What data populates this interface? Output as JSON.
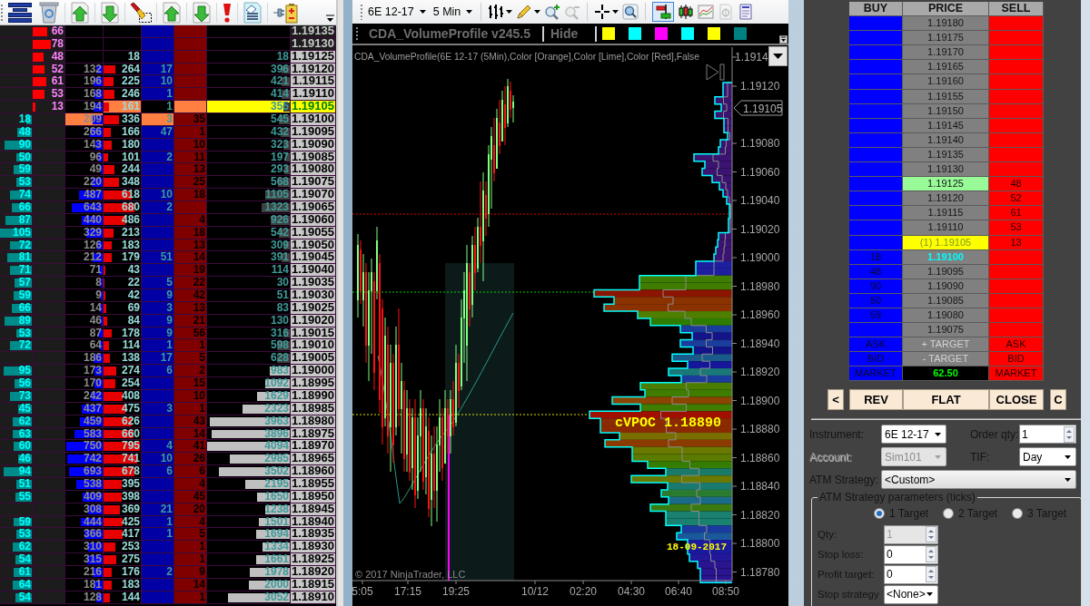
{
  "ladder": {
    "rows": [
      {
        "cells": [
          null,
          {
            "text": "66",
            "level": 0.47
          },
          null,
          null,
          null,
          null,
          null,
          {
            "text": "1.19135",
            "highlight": {
              "color": "#1c1c1c"
            }
          }
        ]
      },
      {
        "cells": [
          null,
          {
            "text": "78",
            "level": 0.56
          },
          null,
          null,
          null,
          null,
          null,
          {
            "text": "1.19130",
            "highlight": {
              "color": "#1c1c1c"
            }
          }
        ]
      },
      {
        "cells": [
          null,
          {
            "text": "48",
            "level": 0.34
          },
          null,
          {
            "text": "18"
          },
          null,
          null,
          {
            "text": "18"
          },
          {
            "text": "1.19125"
          }
        ]
      },
      {
        "cells": [
          null,
          {
            "text": "52",
            "level": 0.37
          },
          {
            "text": "132",
            "level": 0.17
          },
          {
            "text": "264",
            "level": 0.32
          },
          {
            "text": "17"
          },
          null,
          {
            "text": "396",
            "level": 0.1,
            "color": "#404040"
          },
          {
            "text": "1.19120"
          }
        ]
      },
      {
        "cells": [
          null,
          {
            "text": "61",
            "level": 0.44
          },
          {
            "text": "196",
            "level": 0.25
          },
          {
            "text": "225",
            "level": 0.27
          },
          {
            "text": "10"
          },
          null,
          {
            "text": "421",
            "level": 0.1,
            "color": "#404040"
          },
          {
            "text": "1.19115"
          }
        ]
      },
      {
        "cells": [
          null,
          {
            "text": "53",
            "level": 0.38
          },
          {
            "text": "168",
            "level": 0.22
          },
          {
            "text": "246",
            "level": 0.3
          },
          {
            "text": "1"
          },
          null,
          {
            "text": "414",
            "level": 0.1,
            "color": "#404040"
          },
          {
            "text": "1.19110"
          }
        ]
      },
      {
        "cells": [
          null,
          {
            "text": "13",
            "level": 0.09
          },
          {
            "text": "194",
            "level": 0.25
          },
          {
            "text": "161",
            "level": 0.15,
            "highlight": {
              "color": "#ff8040"
            }
          },
          {
            "text": "1",
            "highlight": {
              "color": "#000000"
            }
          },
          {
            "highlight": {
              "color": "#ff8040"
            }
          },
          {
            "text": "355",
            "level": 0.08,
            "color": "#404040",
            "highlight": {
              "color": "#ffff00"
            }
          },
          {
            "text": "1.19105",
            "highlight": {
              "color": "#ffff00"
            }
          }
        ]
      },
      {
        "cells": [
          {
            "text": "18",
            "level": 0.17
          },
          null,
          {
            "text": "209",
            "level": 0.27,
            "highlight": {
              "color": "#ff8040"
            }
          },
          {
            "text": "336",
            "level": 0.41
          },
          {
            "text": "3",
            "highlight": {
              "color": "#ff8040"
            }
          },
          {
            "text": "35"
          },
          {
            "text": "545",
            "level": 0.13,
            "color": "#404040"
          },
          {
            "text": "1.19100"
          }
        ]
      },
      {
        "cells": [
          {
            "text": "48",
            "level": 0.46
          },
          null,
          {
            "text": "266",
            "level": 0.35
          },
          {
            "text": "166",
            "level": 0.2
          },
          {
            "text": "47"
          },
          {
            "text": "1"
          },
          {
            "text": "432",
            "level": 0.11,
            "color": "#404040"
          },
          {
            "text": "1.19095"
          }
        ]
      },
      {
        "cells": [
          {
            "text": "90",
            "level": 0.86
          },
          null,
          {
            "text": "143",
            "level": 0.19
          },
          {
            "text": "180",
            "level": 0.22
          },
          null,
          {
            "text": "10"
          },
          {
            "text": "323",
            "level": 0.08,
            "color": "#404040"
          },
          {
            "text": "1.19090"
          }
        ]
      },
      {
        "cells": [
          {
            "text": "50",
            "level": 0.48
          },
          null,
          {
            "text": "96",
            "level": 0.12
          },
          {
            "text": "101",
            "level": 0.12
          },
          {
            "text": "2"
          },
          {
            "text": "11"
          },
          {
            "text": "197",
            "level": 0.05,
            "color": "#404040"
          },
          {
            "text": "1.19085"
          }
        ]
      },
      {
        "cells": [
          {
            "text": "59",
            "level": 0.56
          },
          null,
          {
            "text": "49",
            "level": 0.06
          },
          {
            "text": "244",
            "level": 0.3
          },
          null,
          {
            "text": "13"
          },
          {
            "text": "293",
            "level": 0.07,
            "color": "#404040"
          },
          {
            "text": "1.19080"
          }
        ]
      },
      {
        "cells": [
          {
            "text": "53",
            "level": 0.5
          },
          null,
          {
            "text": "220",
            "level": 0.29
          },
          {
            "text": "348",
            "level": 0.42
          },
          null,
          {
            "text": "25"
          },
          {
            "text": "568",
            "level": 0.14,
            "color": "#404040"
          },
          {
            "text": "1.19075"
          }
        ]
      },
      {
        "cells": [
          {
            "text": "74",
            "level": 0.7
          },
          null,
          {
            "text": "487",
            "level": 0.63
          },
          {
            "text": "618",
            "level": 0.75
          },
          {
            "text": "10"
          },
          {
            "text": "18"
          },
          {
            "text": "1105",
            "level": 0.3,
            "color": "#404040"
          },
          {
            "text": "1.19070"
          }
        ]
      },
      {
        "cells": [
          {
            "text": "66",
            "level": 0.63
          },
          null,
          {
            "text": "643",
            "level": 0.84
          },
          {
            "text": "680",
            "level": 0.83
          },
          {
            "text": "2"
          },
          null,
          {
            "text": "1323",
            "level": 0.34,
            "color": "#404040"
          },
          {
            "text": "1.19065"
          }
        ]
      },
      {
        "cells": [
          {
            "text": "87",
            "level": 0.83
          },
          null,
          {
            "text": "440",
            "level": 0.57
          },
          {
            "text": "486",
            "level": 0.59
          },
          null,
          {
            "text": "4"
          },
          {
            "text": "926",
            "level": 0.23,
            "color": "#404040"
          },
          {
            "text": "1.19060"
          }
        ]
      },
      {
        "cells": [
          {
            "text": "105",
            "level": 1
          },
          null,
          {
            "text": "329",
            "level": 0.43
          },
          {
            "text": "213",
            "level": 0.26
          },
          null,
          {
            "text": "18"
          },
          {
            "text": "542",
            "level": 0.13,
            "color": "#404040"
          },
          {
            "text": "1.19055"
          }
        ]
      },
      {
        "cells": [
          {
            "text": "72",
            "level": 0.69
          },
          null,
          {
            "text": "126",
            "level": 0.16
          },
          {
            "text": "183",
            "level": 0.22
          },
          null,
          {
            "text": "13"
          },
          {
            "text": "309",
            "level": 0.08,
            "color": "#404040"
          },
          {
            "text": "1.19050"
          }
        ]
      },
      {
        "cells": [
          {
            "text": "81",
            "level": 0.77
          },
          null,
          {
            "text": "212",
            "level": 0.28
          },
          {
            "text": "179",
            "level": 0.22
          },
          {
            "text": "51"
          },
          {
            "text": "14"
          },
          {
            "text": "391",
            "level": 0.1,
            "color": "#404040"
          },
          {
            "text": "1.19045"
          }
        ]
      },
      {
        "cells": [
          {
            "text": "71",
            "level": 0.68
          },
          null,
          {
            "text": "71",
            "level": 0.09
          },
          {
            "text": "43",
            "level": 0.05
          },
          null,
          {
            "text": "19"
          },
          {
            "text": "114"
          },
          {
            "text": "1.19040"
          }
        ]
      },
      {
        "cells": [
          {
            "text": "57",
            "level": 0.54
          },
          null,
          {
            "text": "8",
            "level": 0.04
          },
          {
            "text": "22",
            "level": 0.03
          },
          {
            "text": "5"
          },
          {
            "text": "22"
          },
          {
            "text": "30"
          },
          {
            "text": "1.19035"
          }
        ]
      },
      {
        "cells": [
          {
            "text": "59",
            "level": 0.56
          },
          null,
          {
            "text": "9",
            "level": 0.04
          },
          {
            "text": "42",
            "level": 0.05
          },
          {
            "text": "9"
          },
          {
            "text": "42"
          },
          {
            "text": "51"
          },
          {
            "text": "1.19030"
          }
        ]
      },
      {
        "cells": [
          {
            "text": "66",
            "level": 0.63
          },
          null,
          {
            "text": "14",
            "level": 0.05
          },
          {
            "text": "69",
            "level": 0.08
          },
          {
            "text": "3"
          },
          {
            "text": "13"
          },
          {
            "text": "83"
          },
          {
            "text": "1.19025"
          }
        ]
      },
      {
        "cells": [
          {
            "text": "89",
            "level": 0.85
          },
          null,
          {
            "text": "46",
            "level": 0.06
          },
          {
            "text": "84",
            "level": 0.1
          },
          {
            "text": "9"
          },
          {
            "text": "21"
          },
          {
            "text": "130"
          },
          {
            "text": "1.19020"
          }
        ]
      },
      {
        "cells": [
          {
            "text": "53",
            "level": 0.5
          },
          null,
          {
            "text": "87",
            "level": 0.11
          },
          {
            "text": "178",
            "level": 0.22
          },
          {
            "text": "9"
          },
          {
            "text": "56"
          },
          {
            "text": "316",
            "level": 0.08,
            "color": "#404040"
          },
          {
            "text": "1.19015"
          }
        ]
      },
      {
        "cells": [
          {
            "text": "72",
            "level": 0.69
          },
          null,
          {
            "text": "64",
            "level": 0.08
          },
          {
            "text": "114",
            "level": 0.14
          },
          {
            "text": "1"
          },
          {
            "text": "1"
          },
          {
            "text": "598",
            "level": 0.15,
            "color": "#404040"
          },
          {
            "text": "1.19010"
          }
        ]
      },
      {
        "cells": [
          null,
          null,
          {
            "text": "186",
            "level": 0.24
          },
          {
            "text": "138",
            "level": 0.17
          },
          {
            "text": "17"
          },
          {
            "text": "5"
          },
          {
            "text": "628",
            "level": 0.15,
            "color": "#404040"
          },
          {
            "text": "1.19005"
          }
        ]
      },
      {
        "cells": [
          {
            "text": "95",
            "level": 0.9
          },
          null,
          {
            "text": "173",
            "level": 0.22
          },
          {
            "text": "274",
            "level": 0.33
          },
          {
            "text": "6"
          },
          {
            "text": "2"
          },
          {
            "text": "983",
            "level": 0.24,
            "color": "#c0c0c0"
          },
          {
            "text": "1.19000"
          }
        ]
      },
      {
        "cells": [
          {
            "text": "56",
            "level": 0.53
          },
          null,
          {
            "text": "170",
            "level": 0.22
          },
          {
            "text": "254",
            "level": 0.31
          },
          null,
          {
            "text": "15"
          },
          {
            "text": "1092",
            "level": 0.3,
            "color": "#c0c0c0"
          },
          {
            "text": "1.18995"
          }
        ]
      },
      {
        "cells": [
          {
            "text": "73",
            "level": 0.7
          },
          null,
          {
            "text": "242",
            "level": 0.31
          },
          {
            "text": "408",
            "level": 0.5
          },
          null,
          {
            "text": "10"
          },
          {
            "text": "1629",
            "level": 0.4,
            "color": "#c0c0c0"
          },
          {
            "text": "1.18990"
          }
        ]
      },
      {
        "cells": [
          {
            "text": "45",
            "level": 0.43
          },
          null,
          {
            "text": "437",
            "level": 0.57
          },
          {
            "text": "475",
            "level": 0.58
          },
          {
            "text": "3"
          },
          {
            "text": "1"
          },
          {
            "text": "2323",
            "level": 0.57,
            "color": "#c0c0c0"
          },
          {
            "text": "1.18985"
          }
        ]
      },
      {
        "cells": [
          {
            "text": "62",
            "level": 0.59
          },
          null,
          {
            "text": "459",
            "level": 0.6
          },
          {
            "text": "626",
            "level": 0.76
          },
          null,
          {
            "text": "43"
          },
          {
            "text": "3963",
            "level": 0.97,
            "color": "#c0c0c0"
          },
          {
            "text": "1.18980"
          }
        ]
      },
      {
        "cells": [
          {
            "text": "63",
            "level": 0.6
          },
          null,
          {
            "text": "583",
            "level": 0.76
          },
          {
            "text": "660",
            "level": 0.8
          },
          null,
          {
            "text": "14"
          },
          {
            "text": "3896",
            "level": 0.95,
            "color": "#c0c0c0"
          },
          {
            "text": "1.18975"
          }
        ]
      },
      {
        "cells": [
          {
            "text": "60",
            "level": 0.57
          },
          null,
          {
            "text": "750",
            "level": 0.97
          },
          {
            "text": "795",
            "level": 0.97
          },
          {
            "text": "4"
          },
          {
            "text": "41"
          },
          {
            "text": "4094",
            "level": 1,
            "color": "#c0c0c0"
          },
          {
            "text": "1.18970"
          }
        ]
      },
      {
        "cells": [
          {
            "text": "46",
            "level": 0.44
          },
          null,
          {
            "text": "742",
            "level": 0.96
          },
          {
            "text": "741",
            "level": 0.9
          },
          {
            "text": "10"
          },
          {
            "text": "26"
          },
          {
            "text": "2985",
            "level": 0.73,
            "color": "#c0c0c0"
          },
          {
            "text": "1.18965"
          }
        ]
      },
      {
        "cells": [
          {
            "text": "94",
            "level": 0.9
          },
          null,
          {
            "text": "693",
            "level": 0.9
          },
          {
            "text": "678",
            "level": 0.83
          },
          {
            "text": "6"
          },
          {
            "text": "6"
          },
          {
            "text": "3502",
            "level": 0.86,
            "color": "#c0c0c0"
          },
          {
            "text": "1.18960"
          }
        ]
      },
      {
        "cells": [
          {
            "text": "51",
            "level": 0.49
          },
          null,
          {
            "text": "538",
            "level": 0.7
          },
          {
            "text": "395",
            "level": 0.48
          },
          null,
          {
            "text": "4"
          },
          {
            "text": "2195",
            "level": 0.54,
            "color": "#c0c0c0"
          },
          {
            "text": "1.18955"
          }
        ]
      },
      {
        "cells": [
          {
            "text": "55",
            "level": 0.52
          },
          null,
          {
            "text": "409",
            "level": 0.53
          },
          {
            "text": "398",
            "level": 0.49
          },
          null,
          {
            "text": "45"
          },
          {
            "text": "1650",
            "level": 0.4,
            "color": "#c0c0c0"
          },
          {
            "text": "1.18950"
          }
        ]
      },
      {
        "cells": [
          null,
          null,
          {
            "text": "308",
            "level": 0.4
          },
          {
            "text": "369",
            "level": 0.45
          },
          {
            "text": "21"
          },
          {
            "text": "20"
          },
          {
            "text": "1238",
            "level": 0.3,
            "color": "#c0c0c0"
          },
          {
            "text": "1.18945"
          }
        ]
      },
      {
        "cells": [
          {
            "text": "59",
            "level": 0.56
          },
          null,
          {
            "text": "444",
            "level": 0.58
          },
          {
            "text": "425",
            "level": 0.52
          },
          {
            "text": "1"
          },
          {
            "text": "4"
          },
          {
            "text": "1501",
            "level": 0.37,
            "color": "#c0c0c0"
          },
          {
            "text": "1.18940"
          }
        ]
      },
      {
        "cells": [
          {
            "text": "53",
            "level": 0.5
          },
          null,
          {
            "text": "366",
            "level": 0.48
          },
          {
            "text": "417",
            "level": 0.51
          },
          {
            "text": "1"
          },
          {
            "text": "5"
          },
          {
            "text": "1694",
            "level": 0.41,
            "color": "#c0c0c0"
          },
          {
            "text": "1.18935"
          }
        ]
      },
      {
        "cells": [
          {
            "text": "62",
            "level": 0.59
          },
          null,
          {
            "text": "310",
            "level": 0.4
          },
          {
            "text": "253",
            "level": 0.31
          },
          null,
          {
            "text": "1"
          },
          {
            "text": "1334",
            "level": 0.33,
            "color": "#c0c0c0"
          },
          {
            "text": "1.18930"
          }
        ]
      },
      {
        "cells": [
          {
            "text": "54",
            "level": 0.51
          },
          null,
          {
            "text": "315",
            "level": 0.41
          },
          {
            "text": "275",
            "level": 0.34
          },
          null,
          {
            "text": "1"
          },
          {
            "text": "1661",
            "level": 0.41,
            "color": "#c0c0c0"
          },
          {
            "text": "1.18925"
          }
        ]
      },
      {
        "cells": [
          {
            "text": "61",
            "level": 0.58
          },
          null,
          {
            "text": "216",
            "level": 0.28
          },
          {
            "text": "176",
            "level": 0.21
          },
          {
            "text": "2"
          },
          {
            "text": "9"
          },
          {
            "text": "1978",
            "level": 0.48,
            "color": "#c0c0c0"
          },
          {
            "text": "1.18920"
          }
        ]
      },
      {
        "cells": [
          {
            "text": "64",
            "level": 0.61
          },
          null,
          {
            "text": "181",
            "level": 0.24
          },
          {
            "text": "183",
            "level": 0.22
          },
          null,
          {
            "text": "14"
          },
          {
            "text": "2000",
            "level": 0.49,
            "color": "#c0c0c0"
          },
          {
            "text": "1.18915"
          }
        ]
      },
      {
        "cells": [
          {
            "text": "54",
            "level": 0.51
          },
          null,
          {
            "text": "128",
            "level": 0.17
          },
          {
            "text": "144",
            "level": 0.18
          },
          null,
          {
            "text": "1"
          },
          {
            "text": "3052",
            "level": 0.75,
            "color": "#c0c0c0"
          },
          {
            "text": "1.18910"
          }
        ]
      }
    ]
  },
  "chart_toolbar": {
    "instrument": "6E 12-17",
    "interval": "5 Min",
    "tools": [
      {
        "disabled": false,
        "selected": false
      },
      {
        "disabled": false,
        "selected": false
      },
      {
        "disabled": false,
        "selected": false
      },
      {
        "disabled": true,
        "selected": false
      },
      {
        "disabled": false,
        "selected": false
      },
      {
        "disabled": false,
        "selected": false
      },
      {
        "disabled": false,
        "selected": true
      },
      {
        "disabled": false,
        "selected": false
      },
      {
        "disabled": false,
        "selected": false
      },
      {
        "disabled": true,
        "selected": false
      },
      {
        "disabled": false,
        "selected": false
      }
    ]
  },
  "indicator_bar": {
    "title": "CDA_VolumeProfile v245.5",
    "hide_label": "Hide",
    "swatches": [
      {
        "color": "#ffff00"
      },
      {
        "color": "#00ffff"
      },
      {
        "color": "#ff00ff"
      },
      {
        "color": "#00ffff"
      },
      {
        "color": "#ffff00"
      },
      {
        "color": "#008080"
      }
    ]
  },
  "chart": {
    "indicator_label": "CDA_VolumeProfile(6E 12-17 (5Min),Color [Orange],Color [Lime],Color [Red],False",
    "price_axis_labels": [
      "1.1914",
      "1.19120",
      "1.19080",
      "1.19060",
      "1.19040",
      "1.19020",
      "1.19000",
      "1.18980",
      "1.18960",
      "1.18940",
      "1.18920",
      "1.18900",
      "1.18880",
      "1.18860",
      "1.18840",
      "1.18820",
      "1.18800",
      "1.18780"
    ],
    "last_price": "1.19105",
    "time_axis_labels": [
      "5:05",
      "17:15",
      "19:25",
      "10/12",
      "02:20",
      "04:30",
      "06:40",
      "08:50"
    ],
    "vpoc_label": "cVPOC 1.18890",
    "date_label": "18-09-2017",
    "copyright": "© 2017 NinjaTrader, LLC"
  },
  "dom": {
    "headers": [
      "BUY",
      "PRICE",
      "SELL"
    ],
    "rows": [
      {
        "kind": "price",
        "price": "1.19180"
      },
      {
        "kind": "price",
        "price": "1.19175"
      },
      {
        "kind": "price",
        "price": "1.19170"
      },
      {
        "kind": "price",
        "price": "1.19165"
      },
      {
        "kind": "price",
        "price": "1.19160"
      },
      {
        "kind": "price",
        "price": "1.19155"
      },
      {
        "kind": "price",
        "price": "1.19150"
      },
      {
        "kind": "price",
        "price": "1.19145"
      },
      {
        "kind": "price",
        "price": "1.19140"
      },
      {
        "kind": "price",
        "price": "1.19135"
      },
      {
        "kind": "price",
        "price": "1.19130"
      },
      {
        "kind": "best_ask",
        "price": "1.19125",
        "sell": "48"
      },
      {
        "kind": "price",
        "price": "1.19120",
        "sell": "52"
      },
      {
        "kind": "price",
        "price": "1.19115",
        "sell": "61"
      },
      {
        "kind": "price",
        "price": "1.19110",
        "sell": "53"
      },
      {
        "kind": "last",
        "price": "(1) 1.19105",
        "sell": "13"
      },
      {
        "kind": "best_bid",
        "buy": "18",
        "price": "1.19100"
      },
      {
        "kind": "price",
        "buy": "48",
        "price": "1.19095"
      },
      {
        "kind": "price",
        "buy": "90",
        "price": "1.19090"
      },
      {
        "kind": "price",
        "buy": "50",
        "price": "1.19085"
      },
      {
        "kind": "price",
        "buy": "59",
        "price": "1.19080"
      },
      {
        "kind": "price",
        "price": "1.19075"
      },
      {
        "kind": "order",
        "buy": "ASK",
        "price": "+ TARGET",
        "sell": "ASK"
      },
      {
        "kind": "order",
        "buy": "BID",
        "price": "- TARGET",
        "sell": "BID"
      },
      {
        "kind": "pnl",
        "buy": "MARKET",
        "price": "62.50",
        "sell": "MARKET"
      }
    ],
    "buttons": [
      "<",
      "REV",
      "FLAT",
      "CLOSE",
      "C"
    ]
  },
  "order_form": {
    "instrument": {
      "label": "Instrument:",
      "value": "6E 12-17",
      "disabled": false
    },
    "order_qty": {
      "label": "Order qty:",
      "value": "1",
      "disabled": false
    },
    "account": {
      "label": "Account:",
      "value": "Sim101",
      "disabled": true
    },
    "tif": {
      "label": "TIF:",
      "value": "Day",
      "disabled": false
    },
    "atm_strategy": {
      "label": "ATM Strategy:",
      "value": "<Custom>",
      "disabled": false
    },
    "atm_parameters": {
      "legend": "ATM Strategy parameters (ticks)",
      "targets": [
        {
          "label": "1 Target",
          "selected": true
        },
        {
          "label": "2 Target",
          "selected": false
        },
        {
          "label": "3 Target",
          "selected": false
        }
      ],
      "qty": {
        "label": "Qty:",
        "value": "1",
        "disabled": true
      },
      "stop_loss": {
        "label": "Stop loss:",
        "value": "0",
        "disabled": false
      },
      "profit_target": {
        "label": "Profit target:",
        "value": "0",
        "disabled": false
      },
      "stop_strategy": {
        "label": "Stop strategy",
        "value": "<None>",
        "disabled": false
      }
    }
  }
}
